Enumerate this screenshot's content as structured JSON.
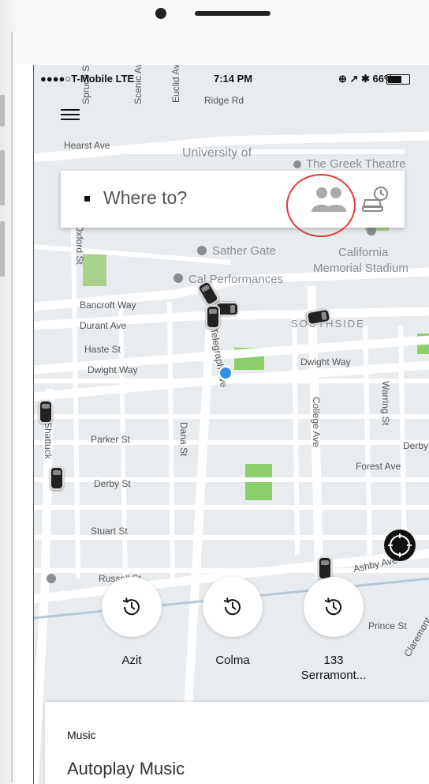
{
  "status": {
    "carrier": "●●●●○T-Mobile LTE",
    "time": "7:14 PM",
    "right_icons": "⊕ ↗ ✱ 66%",
    "battery_level": 0.66
  },
  "search": {
    "placeholder": "Where to?"
  },
  "map_labels": {
    "spruce": "Spruce St",
    "scenic": "Scenic Ave",
    "euclid": "Euclid Ave",
    "ridge": "Ridge Rd",
    "hearst": "Hearst Ave",
    "university": "University of",
    "greek": "The Greek Theatre",
    "oxford": "Oxford St",
    "sather": "Sather Gate",
    "california": "California",
    "memorial": "Memorial Stadium",
    "cal_perf": "Cal Performances",
    "bancroft": "Bancroft Way",
    "durant": "Durant Ave",
    "southside": "SOUTHSIDE",
    "haste": "Haste St",
    "telegraph": "Telegraph Ave",
    "dwight1": "Dwight Way",
    "dwight2": "Dwight Way",
    "college": "College Ave",
    "warring": "Warring St",
    "shattuck": "Shattuck",
    "parker": "Parker St",
    "dana": "Dana St",
    "derby_right": "Derby",
    "forest": "Forest Ave",
    "derby": "Derby St",
    "stuart": "Stuart St",
    "russell": "Russell St",
    "ashby": "Ashby Ave",
    "prince": "Prince St",
    "claremont": "Claremont"
  },
  "shortcuts": [
    {
      "label": "Azit"
    },
    {
      "label": "Colma"
    },
    {
      "label": "133\nSerramont..."
    }
  ],
  "sheet": {
    "section": "Music",
    "item": "Autoplay Music"
  }
}
